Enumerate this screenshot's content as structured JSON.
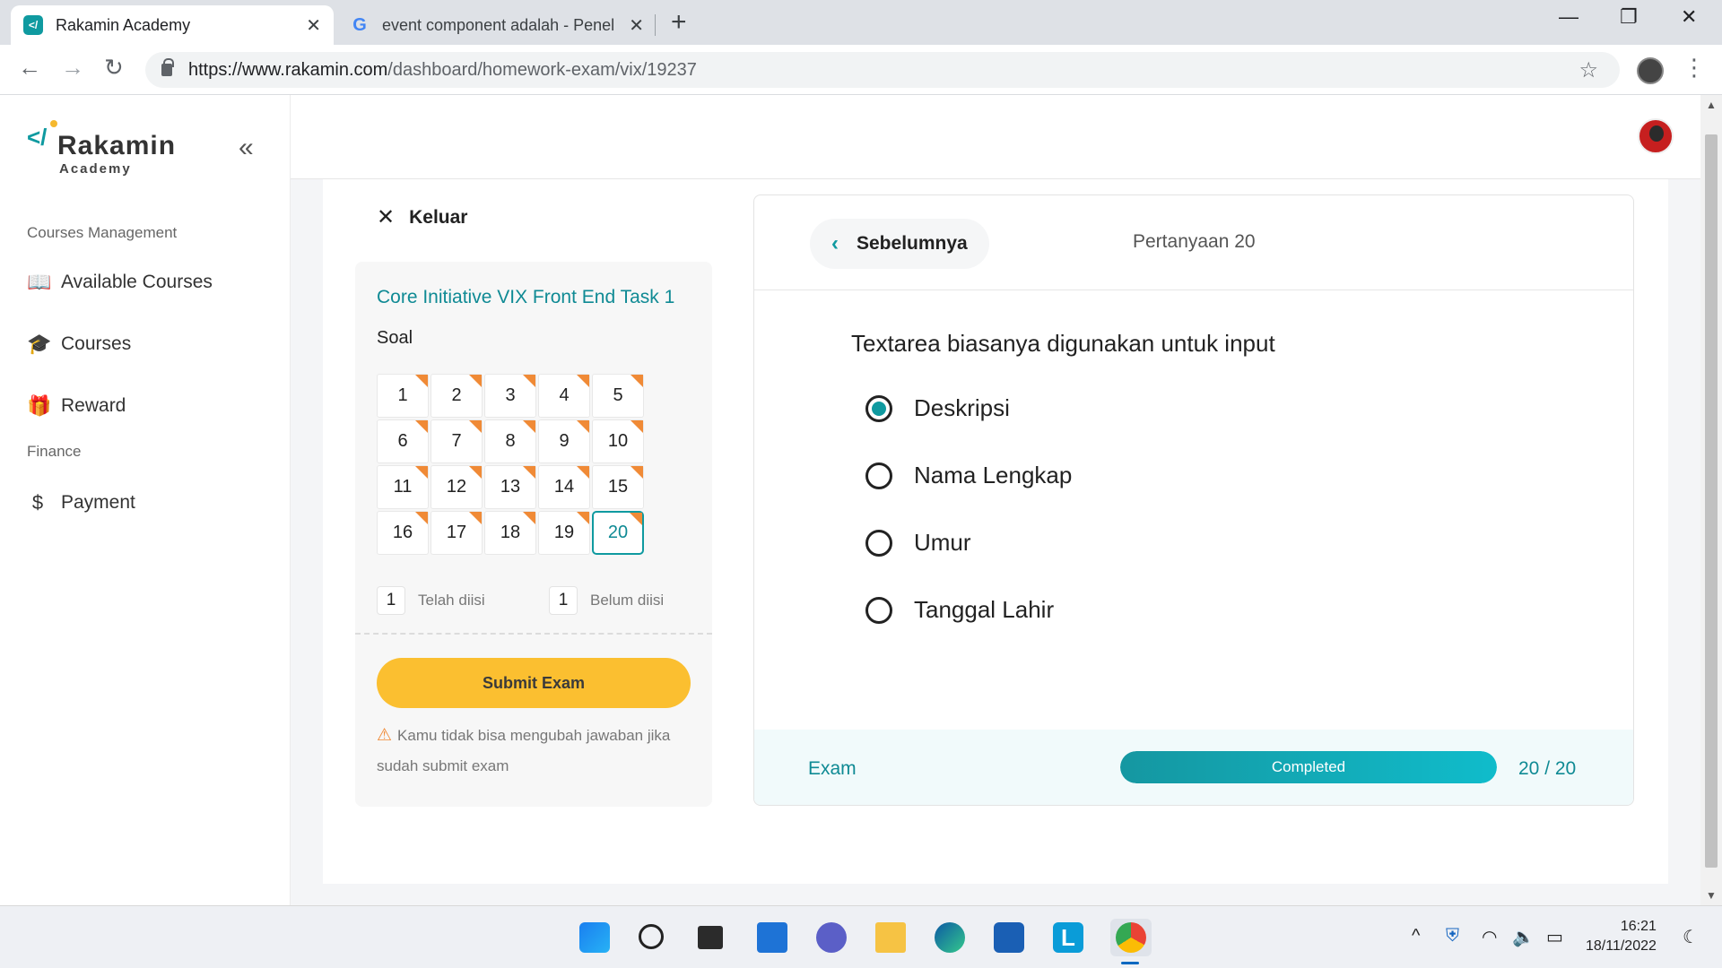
{
  "browser": {
    "tabs": [
      {
        "title": "Rakamin Academy",
        "icon": "rakamin-favicon",
        "active": true
      },
      {
        "title": "event component adalah - Penel",
        "icon": "google-icon",
        "active": false
      }
    ],
    "url_host": "https://www.rakamin.com",
    "url_path": "/dashboard/homework-exam/vix/19237"
  },
  "sidebar": {
    "logo_name": "Rakamin",
    "logo_sub": "Academy",
    "section1": "Courses Management",
    "items1": [
      {
        "label": "Available Courses",
        "icon": "book-icon"
      },
      {
        "label": "Courses",
        "icon": "graduation-cap-icon"
      },
      {
        "label": "Reward",
        "icon": "gift-icon"
      }
    ],
    "section2": "Finance",
    "items2": [
      {
        "label": "Payment",
        "icon": "dollar-icon"
      }
    ]
  },
  "exam": {
    "exit_label": "Keluar",
    "task_title": "Core Initiative VIX Front End Task 1",
    "soal_label": "Soal",
    "questions": [
      "1",
      "2",
      "3",
      "4",
      "5",
      "6",
      "7",
      "8",
      "9",
      "10",
      "11",
      "12",
      "13",
      "14",
      "15",
      "16",
      "17",
      "18",
      "19",
      "20"
    ],
    "current_question": "20",
    "answered_count": "1",
    "answered_label": "Telah diisi",
    "unanswered_count": "1",
    "unanswered_label": "Belum diisi",
    "submit_label": "Submit Exam",
    "warning": "Kamu tidak bisa mengubah jawaban jika sudah submit exam"
  },
  "question": {
    "prev_label": "Sebelumnya",
    "number_label": "Pertanyaan 20",
    "text": "Textarea biasanya digunakan untuk input",
    "options": [
      "Deskripsi",
      "Nama Lengkap",
      "Umur",
      "Tanggal Lahir"
    ],
    "selected_index": 0
  },
  "footer": {
    "exam_label": "Exam",
    "progress_label": "Completed",
    "progress_fraction": 1.0,
    "progress_count": "20 / 20"
  },
  "taskbar": {
    "time": "16:21",
    "date": "18/11/2022"
  },
  "colors": {
    "accent": "#0f9aa0",
    "submit": "#fbbf30",
    "flag": "#f08a36"
  }
}
